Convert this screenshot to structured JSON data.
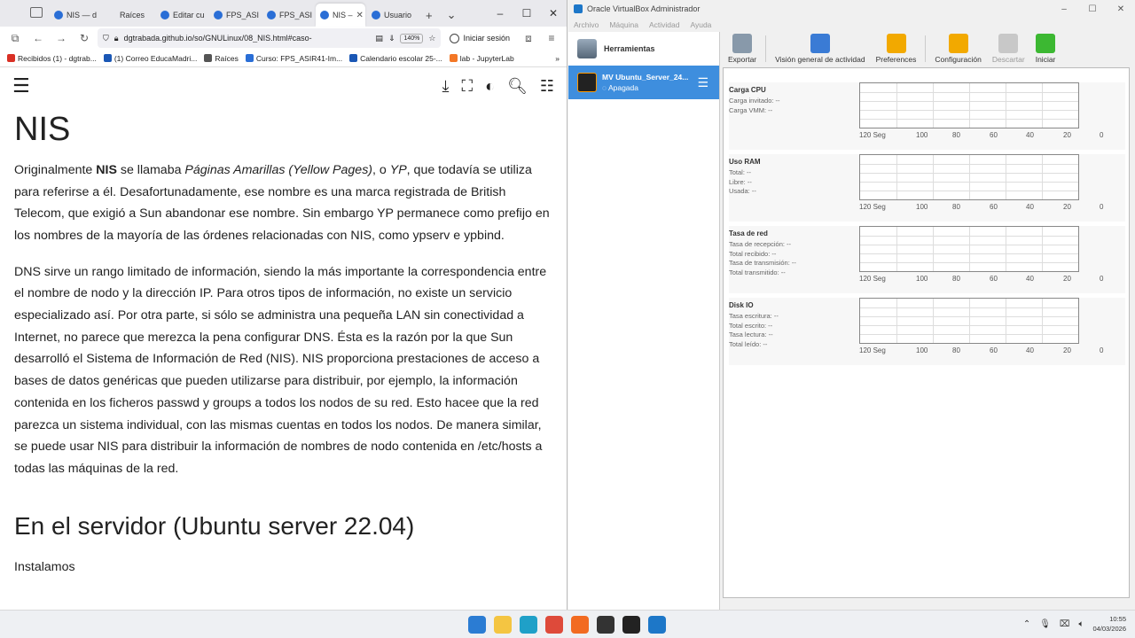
{
  "browser": {
    "tabs": [
      {
        "label": "NIS — d",
        "color": "#2a6ed6"
      },
      {
        "label": "Raíces",
        "color": ""
      },
      {
        "label": "Editar cu",
        "color": "#2a6ed6"
      },
      {
        "label": "FPS_ASI",
        "color": "#2a6ed6"
      },
      {
        "label": "FPS_ASI",
        "color": "#2a6ed6"
      },
      {
        "label": "NIS –",
        "color": "#2a6ed6"
      },
      {
        "label": "Usuario",
        "color": "#2a6ed6"
      }
    ],
    "url": "dgtrabada.github.io/so/GNULinux/08_NIS.html#caso-",
    "zoom": "140%",
    "signin": "Iniciar sesión",
    "bookmarks": [
      {
        "label": "Recibidos (1) - dgtrab...",
        "color": "#d93025"
      },
      {
        "label": "(1) Correo EducaMadri...",
        "color": "#1a57b5"
      },
      {
        "label": "Raíces",
        "color": "#555555"
      },
      {
        "label": "Curso: FPS_ASIR41-Im...",
        "color": "#2a6ed6"
      },
      {
        "label": "Calendario escolar 25-...",
        "color": "#1a57b5"
      },
      {
        "label": "lab - JupyterLab",
        "color": "#f37726"
      }
    ],
    "page": {
      "title": "NIS",
      "p1": {
        "a": "Originalmente ",
        "b": "NIS",
        "c": " se llamaba ",
        "d": "Páginas Amarillas (Yellow Pages)",
        "e": ", o ",
        "f": "YP",
        "g": ", que todavía se utiliza para referirse a él. Desafortunadamente, ese nombre es una marca registrada de British Telecom, que exigió a Sun abandonar ese nombre. Sin embargo YP permanece como prefijo en los nombres de la mayoría de las órdenes relacionadas con NIS, como ypserv e ypbind."
      },
      "p2": "DNS sirve un rango limitado de información, siendo la más importante la correspondencia entre el nombre de nodo y la dirección IP. Para otros tipos de información, no existe un servicio especializado así. Por otra parte, si sólo se administra una pequeña LAN sin conectividad a Internet, no parece que merezca la pena configurar DNS. Ésta es la razón por la que Sun desarrolló el Sistema de Información de Red (NIS). NIS proporciona prestaciones de acceso a bases de datos genéricas que pueden utilizarse para distribuir, por ejemplo, la información contenida en los ficheros passwd y groups a todos los nodos de su red. Esto hacee que la red parezca un sistema individual, con las mismas cuentas en todos los nodos. De manera similar, se puede usar NIS para distribuir la información de nombres de nodo contenida en /etc/hosts a todas las máquinas de la red.",
      "h2": "En el servidor (Ubuntu server 22.04)",
      "p3": "Instalamos"
    }
  },
  "vbox": {
    "title": "Oracle VirtualBox Administrador",
    "menu": [
      "Archivo",
      "Máquina",
      "Actividad",
      "Ayuda"
    ],
    "tools_label": "Herramientas",
    "vm": {
      "name": "MV Ubuntu_Server_24...",
      "state": "Apagada"
    },
    "toolbar": [
      {
        "label": "Exportar",
        "color": "#8899aa",
        "disabled": false
      },
      {
        "label": "Visión general de actividad",
        "color": "#3a7bd5",
        "disabled": false
      },
      {
        "label": "Preferences",
        "color": "#f2a900",
        "disabled": false
      },
      {
        "label": "Configuración",
        "color": "#f2a900",
        "disabled": false
      },
      {
        "label": "Descartar",
        "color": "#c8c8c8",
        "disabled": true
      },
      {
        "label": "Iniciar",
        "color": "#3cb832",
        "disabled": false
      }
    ],
    "axis_ticks": [
      "120 Seg",
      "100",
      "80",
      "60",
      "40",
      "20",
      "0"
    ],
    "panels": [
      {
        "title": "Carga CPU",
        "lines": [
          "Carga invitado: --",
          "Carga VMM: --"
        ]
      },
      {
        "title": "Uso RAM",
        "lines": [
          "Total: --",
          "Libre: --",
          "Usada: --"
        ]
      },
      {
        "title": "Tasa de red",
        "lines": [
          "Tasa de recepción: --",
          "Total recibido: --",
          "Tasa de transmisión: --",
          "Total transmitido: --"
        ]
      },
      {
        "title": "Disk IO",
        "lines": [
          "Tasa escritura: --",
          "Total escrito: --",
          "Tasa lectura: --",
          "Total leído: --"
        ]
      }
    ]
  },
  "taskbar": {
    "apps": [
      {
        "name": "windows-start-icon",
        "color": "#2b7cd3"
      },
      {
        "name": "file-explorer-icon",
        "color": "#f4c542"
      },
      {
        "name": "edge-icon",
        "color": "#1fa0c8"
      },
      {
        "name": "chrome-icon",
        "color": "#de4a3a"
      },
      {
        "name": "firefox-icon",
        "color": "#f26b21"
      },
      {
        "name": "obs-icon",
        "color": "#333333"
      },
      {
        "name": "obs-recording-icon",
        "color": "#222222"
      },
      {
        "name": "virtualbox-icon",
        "color": "#1d77c8"
      }
    ],
    "time": "10:55",
    "date": "04/03/2026"
  }
}
